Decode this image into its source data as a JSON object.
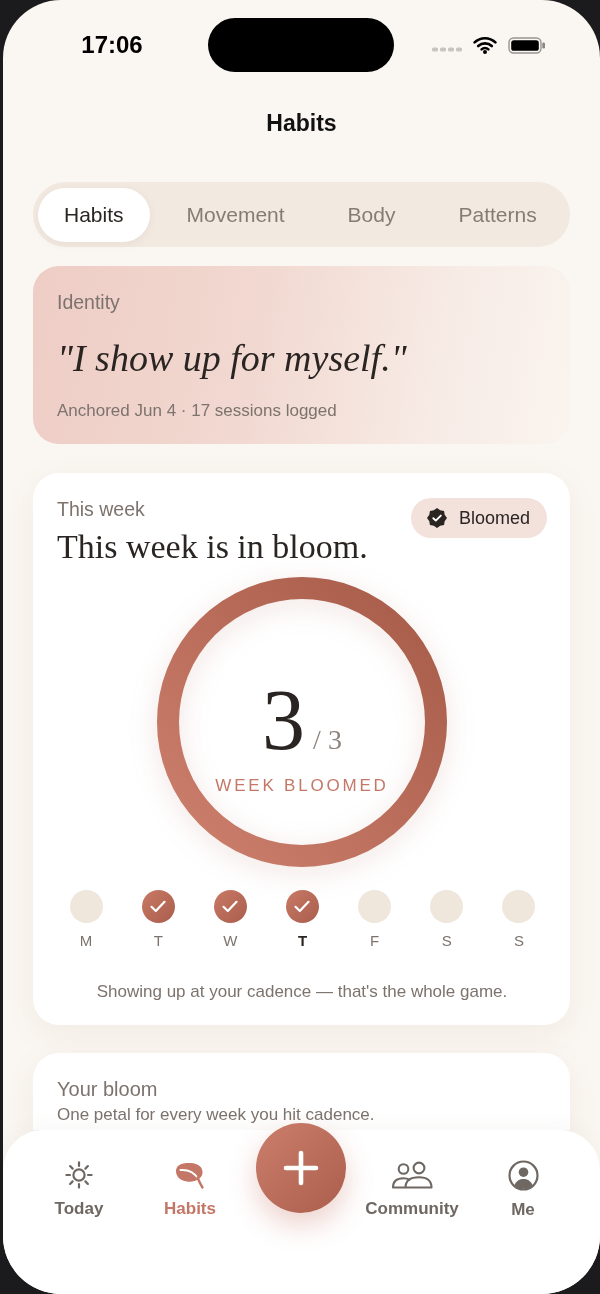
{
  "status_bar": {
    "time": "17:06"
  },
  "title": "Habits",
  "tabs": [
    {
      "label": "Habits",
      "selected": true
    },
    {
      "label": "Movement",
      "selected": false
    },
    {
      "label": "Body",
      "selected": false
    },
    {
      "label": "Patterns",
      "selected": false
    }
  ],
  "identity": {
    "label": "Identity",
    "statement": "\"I show up for myself.\"",
    "meta": "Anchored Jun 4 · 17 sessions logged"
  },
  "week": {
    "label": "This week",
    "headline": "This week is in bloom.",
    "badge": "Bloomed",
    "ring": {
      "level": 1,
      "count": "3",
      "total": "/ 3",
      "caption": "WEEK BLOOMED"
    },
    "days": [
      {
        "label": "M",
        "checked": false,
        "today": false
      },
      {
        "label": "T",
        "checked": true,
        "today": false
      },
      {
        "label": "W",
        "checked": true,
        "today": false
      },
      {
        "label": "T",
        "checked": true,
        "today": true
      },
      {
        "label": "F",
        "checked": false,
        "today": false
      },
      {
        "label": "S",
        "checked": false,
        "today": false
      },
      {
        "label": "S",
        "checked": false,
        "today": false
      }
    ],
    "footnote": "Showing up at your cadence — that's the whole game."
  },
  "bloom": {
    "title": "Your bloom",
    "subtitle": "One petal for every week you hit cadence."
  },
  "nav": [
    {
      "label": "Today",
      "selected": false
    },
    {
      "label": "Habits",
      "selected": true
    },
    {
      "label": "Community",
      "selected": false
    },
    {
      "label": "Me",
      "selected": false
    }
  ]
}
